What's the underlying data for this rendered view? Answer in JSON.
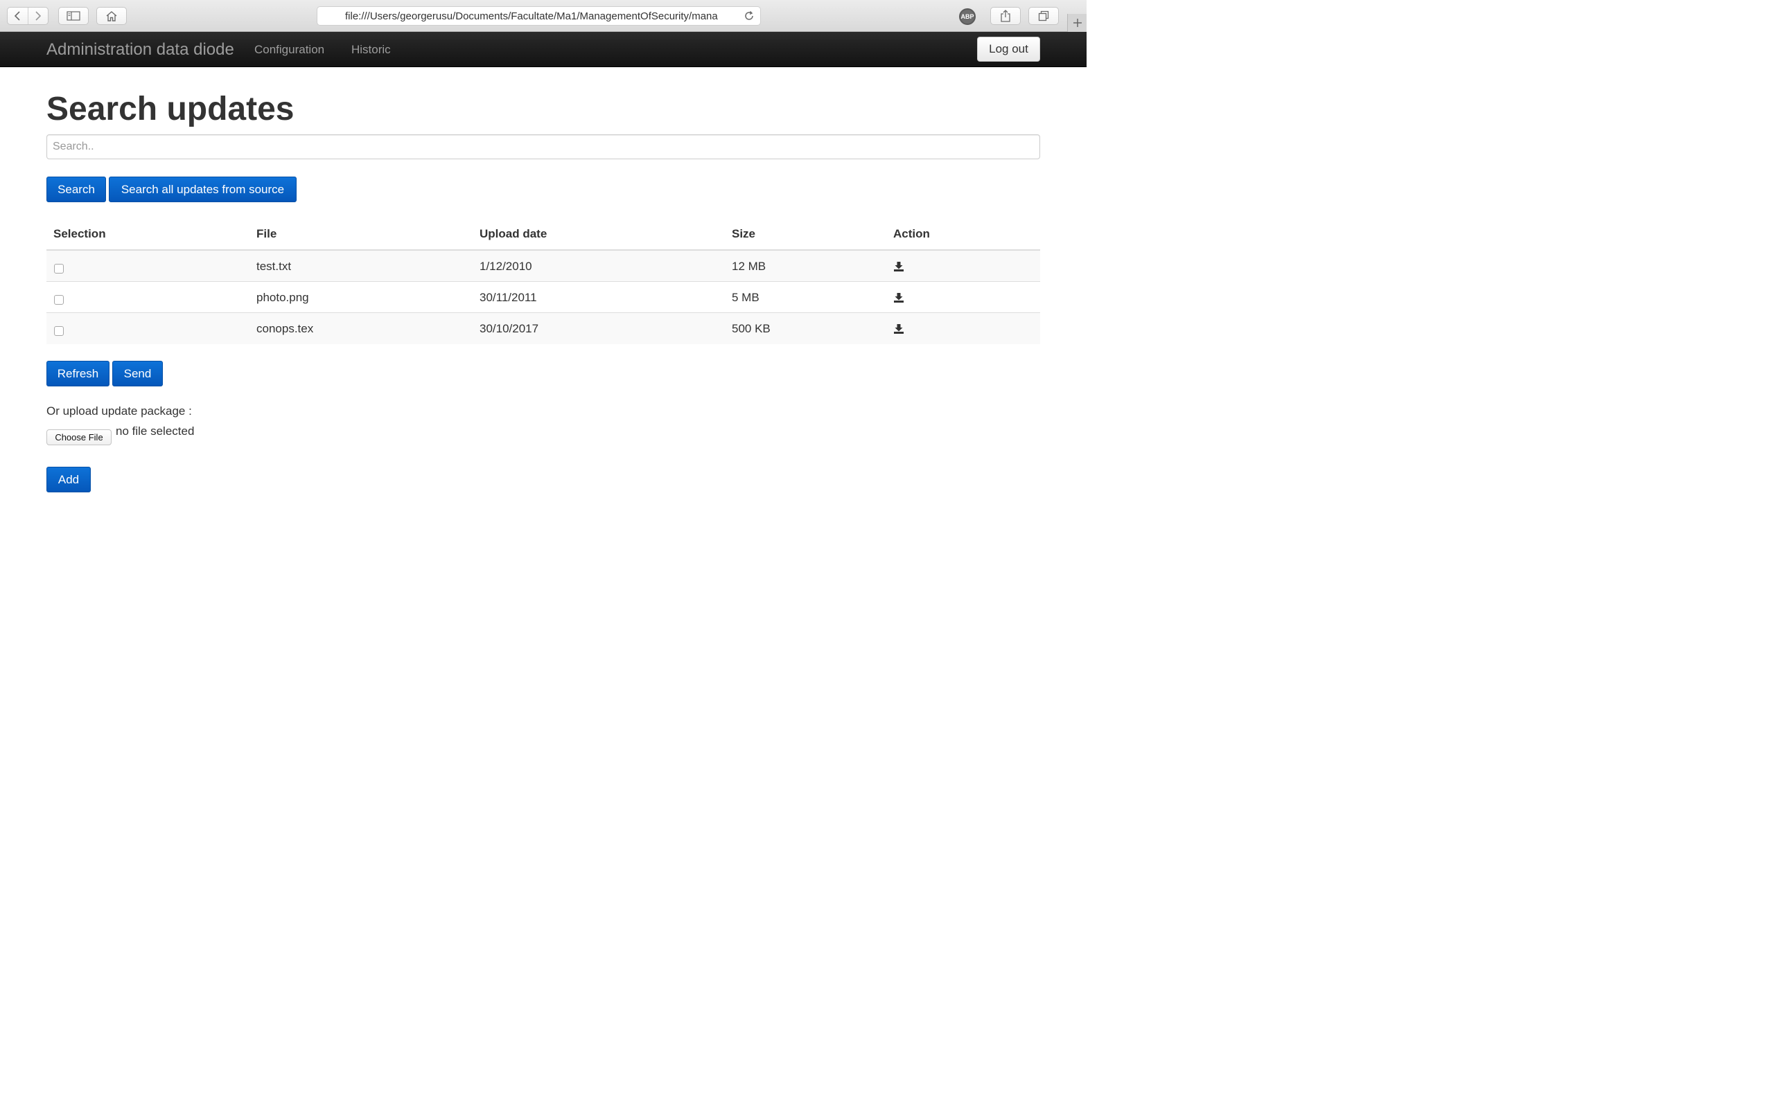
{
  "browser": {
    "url": "file:///Users/georgerusu/Documents/Facultate/Ma1/ManagementOfSecurity/mana",
    "abp_label": "ABP"
  },
  "navbar": {
    "brand": "Administration data diode",
    "links": [
      "Configuration",
      "Historic"
    ],
    "logout_label": "Log out"
  },
  "main": {
    "title": "Search updates",
    "search_placeholder": "Search..",
    "search_button": "Search",
    "search_all_button": "Search all updates from source",
    "table": {
      "headers": [
        "Selection",
        "File",
        "Upload date",
        "Size",
        "Action"
      ],
      "rows": [
        {
          "file": "test.txt",
          "upload_date": "1/12/2010",
          "size": "12 MB",
          "action_icon": "download-icon",
          "selected": false
        },
        {
          "file": "photo.png",
          "upload_date": "30/11/2011",
          "size": "5 MB",
          "action_icon": "download-icon",
          "selected": false
        },
        {
          "file": "conops.tex",
          "upload_date": "30/10/2017",
          "size": "500 KB",
          "action_icon": "download-icon",
          "selected": false
        }
      ]
    },
    "refresh_button": "Refresh",
    "send_button": "Send",
    "upload_label": "Or upload update package :",
    "choose_file_button": "Choose File",
    "no_file_text": "no file selected",
    "add_button": "Add"
  },
  "colors": {
    "primary": "#0a66cc",
    "navbar": "#1b1b1b"
  }
}
